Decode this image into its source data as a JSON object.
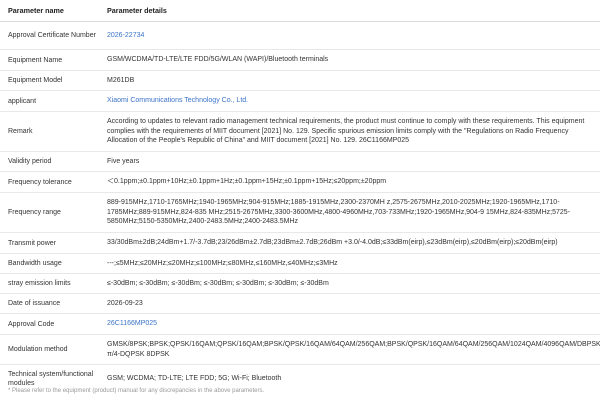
{
  "header": {
    "name": "Parameter name",
    "details": "Parameter details"
  },
  "rows": [
    {
      "name": "Approval Certificate Number",
      "value": "2026-22734",
      "link": true
    },
    {
      "name": "Equipment Name",
      "value": "GSM/WCDMA/TD-LTE/LTE FDD/5G/WLAN (WAPI)/Bluetooth terminals"
    },
    {
      "name": "Equipment Model",
      "value": "M261DB"
    },
    {
      "name": "applicant",
      "value": "Xiaomi Communications Technology Co., Ltd.",
      "link": true
    },
    {
      "name": "Remark",
      "value": "According to updates to relevant radio management technical requirements, the product must continue to comply with these requirements. This equipment complies with the requirements of MIIT document [2021] No. 129. Specific spurious emission limits comply with the \"Regulations on Radio Frequency Allocation of the People's Republic of China\" and MIIT document [2021] No. 129. 26C1166MP025"
    },
    {
      "name": "Validity period",
      "value": "Five years"
    },
    {
      "name": "Frequency tolerance",
      "value": "＜0.1ppm;±0.1ppm+10Hz;±0.1ppm+1Hz;±0.1ppm+15Hz;±0.1ppm+15Hz;≤20ppm;±20ppm"
    },
    {
      "name": "Frequency range",
      "value": "889-915MHz,1710-1765MHz;1940-1965MHz;904-915MHz;1885-1915MHz,2300-2370MH z,2575-2675MHz,2010-2025MHz;1920-1965MHz,1710-1785MHz;889-915MHz,824-835 MHz;2515-2675MHz,3300-3600MHz,4800-4960MHz,703-733MHz;1920-1965MHz,904-9 15MHz,824-835MHz;5725-5850MHz;5150-5350MHz,2400-2483.5MHz;2400-2483.5MHz"
    },
    {
      "name": "Transmit power",
      "value": "33/30dBm±2dB;24dBm+1.7/-3.7dB;23/26dBm±2.7dB;23dBm±2.7dB;26dBm +3.0/-4.0dB;≤33dBm(eirp),≤23dBm(eirp),≤20dBm(eirp);≤20dBm(eirp)"
    },
    {
      "name": "Bandwidth usage",
      "value": "---;≤5MHz;≤20MHz;≤20MHz;≤100MHz;≤80MHz,≤160MHz,≤40MHz;≤3MHz"
    },
    {
      "name": "stray emission limits",
      "value": "≤-30dBm; ≤-30dBm; ≤-30dBm; ≤-30dBm; ≤-30dBm; ≤-30dBm; ≤-30dBm"
    },
    {
      "name": "Date of issuance",
      "value": "2026-09-23"
    },
    {
      "name": "Approval Code",
      "value": "26C1166MP025",
      "link": true
    },
    {
      "name": "Modulation method",
      "value": "GMSK/8PSK;BPSK;QPSK/16QAM;QPSK/16QAM;BPSK/QPSK/16QAM/64QAM/256QAM;BPSK/QPSK/16QAM/64QAM/256QAM/1024QAM/4096QAM/DBPSK/DQPSK/CCK;GFSK/π/4-DQPSK 8DPSK"
    },
    {
      "name": "Technical system/functional modules",
      "value": "GSM; WCDMA; TD-LTE; LTE FDD; 5G; Wi-Fi; Bluetooth"
    }
  ],
  "footnote": "* Please refer to the equipment (product) manual for any discrepancies in the above parameters."
}
